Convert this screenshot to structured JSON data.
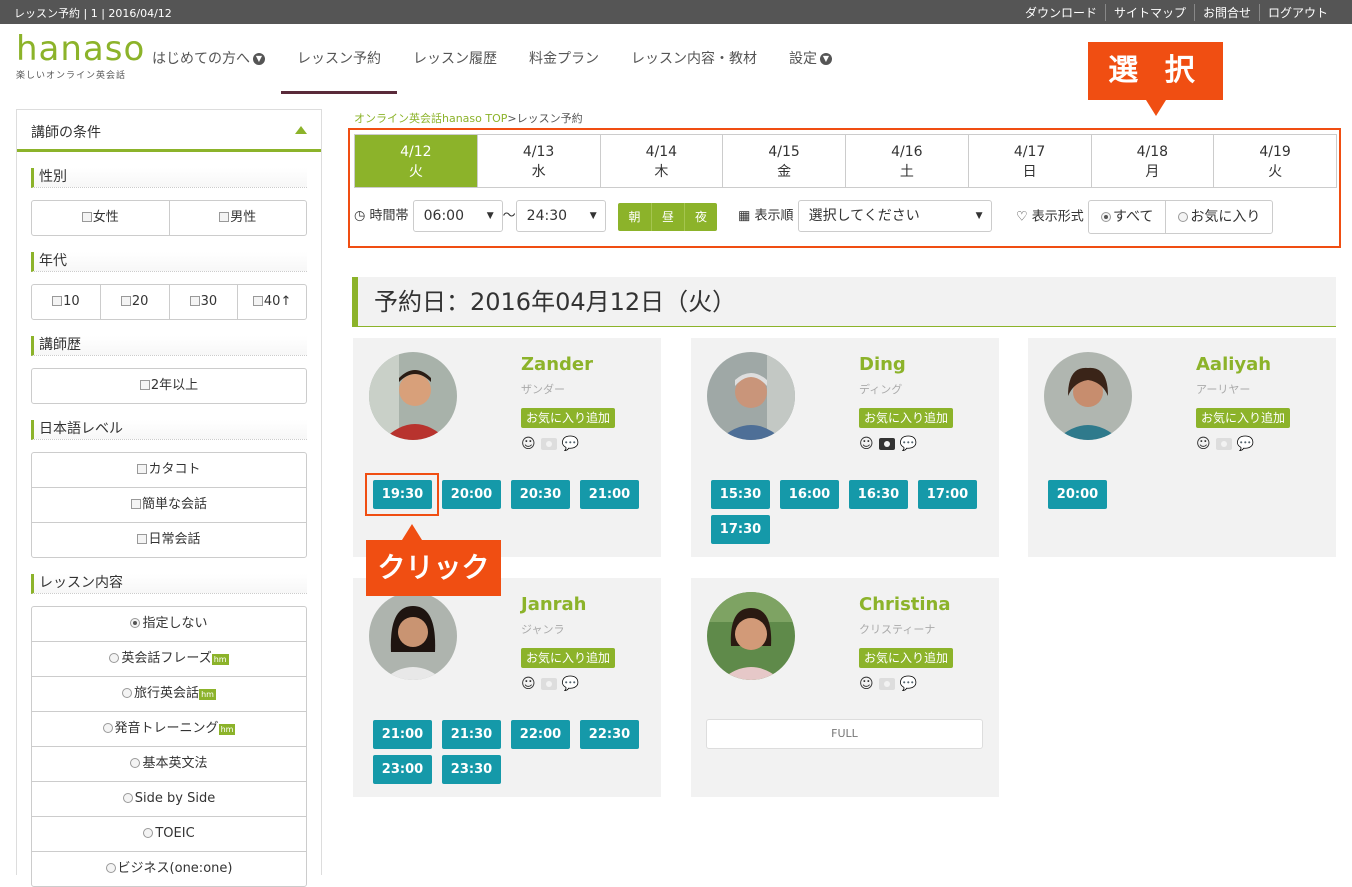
{
  "topbar": {
    "info": "レッスン予約 | 1 | 2016/04/12",
    "links": [
      "ダウンロード",
      "サイトマップ",
      "お問合せ",
      "ログアウト"
    ]
  },
  "logo": {
    "word": "hanaso",
    "tagline": "楽しいオンライン英会話"
  },
  "nav": {
    "items": [
      "はじめての方へ",
      "レッスン予約",
      "レッスン履歴",
      "料金プラン",
      "レッスン内容・教材",
      "設定"
    ]
  },
  "sidebar": {
    "header": "講師の条件",
    "gender": {
      "title": "性別",
      "options": [
        "女性",
        "男性"
      ]
    },
    "age": {
      "title": "年代",
      "options": [
        "10",
        "20",
        "30",
        "40↑"
      ]
    },
    "experience": {
      "title": "講師歴",
      "options": [
        "2年以上"
      ]
    },
    "japanese": {
      "title": "日本語レベル",
      "options": [
        "カタコト",
        "簡単な会話",
        "日常会話"
      ]
    },
    "lesson": {
      "title": "レッスン内容",
      "options": [
        "指定しない",
        "英会話フレーズ",
        "旅行英会話",
        "発音トレーニング",
        "基本英文法",
        "Side by Side",
        "TOEIC",
        "ビジネス(one:one)"
      ],
      "badge": "hm"
    }
  },
  "breadcrumb": {
    "home": "オンライン英会話hanaso TOP",
    "sep": ">",
    "current": "レッスン予約"
  },
  "days": [
    {
      "date": "4/12",
      "dow": "火"
    },
    {
      "date": "4/13",
      "dow": "水"
    },
    {
      "date": "4/14",
      "dow": "木"
    },
    {
      "date": "4/15",
      "dow": "金"
    },
    {
      "date": "4/16",
      "dow": "土"
    },
    {
      "date": "4/17",
      "dow": "日"
    },
    {
      "date": "4/18",
      "dow": "月"
    },
    {
      "date": "4/19",
      "dow": "火"
    }
  ],
  "filters": {
    "time_label": "時間帯",
    "time_from": "06:00",
    "tilde": "～",
    "time_to": "24:30",
    "tod": [
      "朝",
      "昼",
      "夜"
    ],
    "order_label": "表示順",
    "order_value": "選択してください",
    "display_label": "表示形式",
    "display_options": [
      "すべて",
      "お気に入り"
    ]
  },
  "page_title": "予約日：2016年04月12日（火）",
  "fav_label": "お気に入り追加",
  "teachers": [
    {
      "name": "Zander",
      "kana": "ザンダー",
      "slots": [
        "19:30",
        "20:00",
        "20:30",
        "21:00"
      ]
    },
    {
      "name": "Ding",
      "kana": "ディング",
      "slots": [
        "15:30",
        "16:00",
        "16:30",
        "17:00",
        "17:30"
      ]
    },
    {
      "name": "Aaliyah",
      "kana": "アーリヤー",
      "slots": [
        "20:00"
      ]
    },
    {
      "name": "Janrah",
      "kana": "ジャンラ",
      "slots": [
        "21:00",
        "21:30",
        "22:00",
        "22:30",
        "23:00",
        "23:30"
      ]
    },
    {
      "name": "Christina",
      "kana": "クリスティーナ",
      "full": "FULL"
    }
  ],
  "callouts": {
    "select": "選 択",
    "click": "クリック"
  },
  "colors": {
    "brand": "#8cb32a",
    "slot": "#1599a9",
    "accent": "#f04e12"
  }
}
